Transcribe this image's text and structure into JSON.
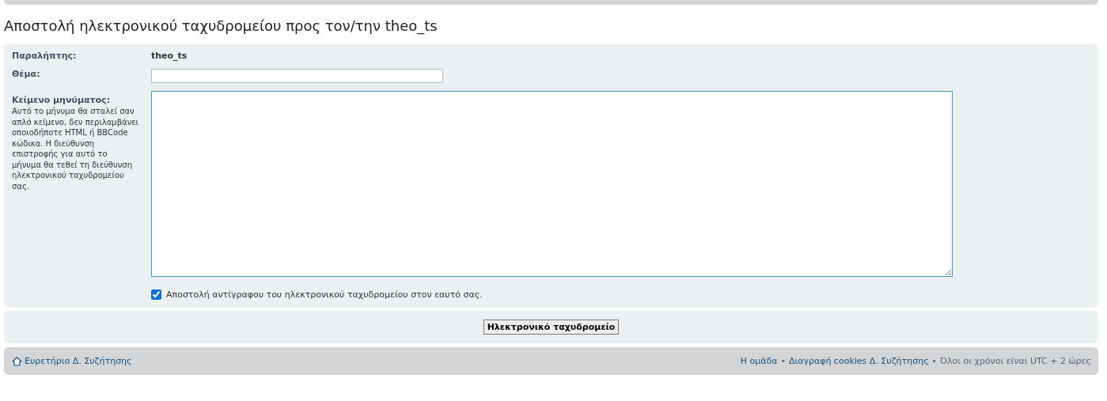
{
  "page_title": "Αποστολή ηλεκτρονικού ταχυδρομείου προς τον/την theo_ts",
  "form": {
    "recipient": {
      "label": "Παραλήπτης:",
      "value": "theo_ts"
    },
    "subject": {
      "label": "Θέμα:"
    },
    "message": {
      "label": "Κείμενο μηνύματος:",
      "help": "Αυτό το μήνυμα θα σταλεί σαν απλό κείμενο, δεν περιλαμβάνει οποιοδήποτε HTML ή BBCode κώδικα. Η διεύθυνση επιστροφής για αυτό το μήνυμα θα τεθεί τη διεύθυνση ηλεκτρονικού ταχυδρομείου σας."
    },
    "copy_checkbox": {
      "label": "Αποστολή αντίγραφου του ηλεκτρονικού ταχυδρομείου στον εαυτό σας.",
      "checked": true
    }
  },
  "submit_button": "Ηλεκτρονικό ταχυδρομείο",
  "footer": {
    "home_link": "Ευρετήριο Δ. Συζήτησης",
    "right": [
      {
        "kind": "link",
        "text": "Η ομάδα"
      },
      {
        "kind": "separator",
        "text": "•"
      },
      {
        "kind": "link",
        "text": "Διαγραφή cookies Δ. Συζήτησης"
      },
      {
        "kind": "separator",
        "text": "•"
      },
      {
        "kind": "text",
        "text": "Όλοι οι χρόνοι είναι UTC + 2 ώρες"
      }
    ]
  }
}
